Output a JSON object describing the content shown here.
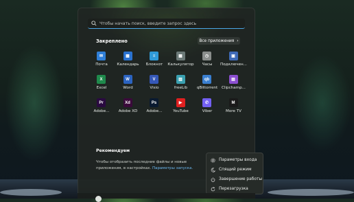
{
  "search": {
    "placeholder": "Чтобы начать поиск, введите запрос здесь"
  },
  "pinned": {
    "title": "Закреплено",
    "all_apps_label": "Все приложения",
    "apps": [
      {
        "label": "Почта",
        "icon": "mail-icon",
        "color": "#2f7fd8",
        "glyph": "✉"
      },
      {
        "label": "Календарь",
        "icon": "calendar-icon",
        "color": "#2a72d0",
        "glyph": "▦"
      },
      {
        "label": "Блокнот",
        "icon": "notepad-icon",
        "color": "#2f9ad8",
        "glyph": "≡"
      },
      {
        "label": "Калькулятор",
        "icon": "calculator-icon",
        "color": "#6c7a78",
        "glyph": "▦"
      },
      {
        "label": "Часы",
        "icon": "clock-icon",
        "color": "#8a8e8c",
        "glyph": "◷"
      },
      {
        "label": "Подключен...",
        "icon": "connect-icon",
        "color": "#3f6ab8",
        "glyph": "▣"
      },
      {
        "label": "Excel",
        "icon": "excel-icon",
        "color": "#1f8a4c",
        "glyph": "X"
      },
      {
        "label": "Word",
        "icon": "word-icon",
        "color": "#2b63c0",
        "glyph": "W"
      },
      {
        "label": "Visio",
        "icon": "visio-icon",
        "color": "#3558b8",
        "glyph": "V"
      },
      {
        "label": "freeLib",
        "icon": "freelib-icon",
        "color": "#3aa0b0",
        "glyph": "▥"
      },
      {
        "label": "qBittorrent",
        "icon": "qbittorrent-icon",
        "color": "#3a7fd0",
        "glyph": "qb"
      },
      {
        "label": "Clipchamp...",
        "icon": "clipchamp-icon",
        "color": "#8b4fd0",
        "glyph": "▤"
      },
      {
        "label": "Adobe...",
        "icon": "premiere-icon",
        "color": "#2a0a40",
        "glyph": "Pr"
      },
      {
        "label": "Adobe XD",
        "icon": "adobe-xd-icon",
        "color": "#3a0a3a",
        "glyph": "Xd"
      },
      {
        "label": "Adobe...",
        "icon": "photoshop-icon",
        "color": "#0a1a30",
        "glyph": "Ps"
      },
      {
        "label": "YouTube",
        "icon": "youtube-icon",
        "color": "#e02020",
        "glyph": "▶"
      },
      {
        "label": "Viber",
        "icon": "viber-icon",
        "color": "#7360f2",
        "glyph": "✆"
      },
      {
        "label": "More TV",
        "icon": "moretv-icon",
        "color": "#1a1a1a",
        "glyph": "M"
      }
    ]
  },
  "recommended": {
    "title": "Рекомендуем",
    "text": "Чтобы отобразить последние файлы и новые приложения, в",
    "text2": "настройках.",
    "link": "Параметры запуска."
  },
  "power_menu": {
    "items": [
      {
        "label": "Параметры входа",
        "icon": "gear-icon"
      },
      {
        "label": "Спящий режим",
        "icon": "moon-icon"
      },
      {
        "label": "Завершение работы",
        "icon": "power-icon"
      },
      {
        "label": "Перезагрузка",
        "icon": "restart-icon"
      }
    ]
  },
  "colors": {
    "accent": "#4aa8e8",
    "link": "#6cb8f0"
  }
}
